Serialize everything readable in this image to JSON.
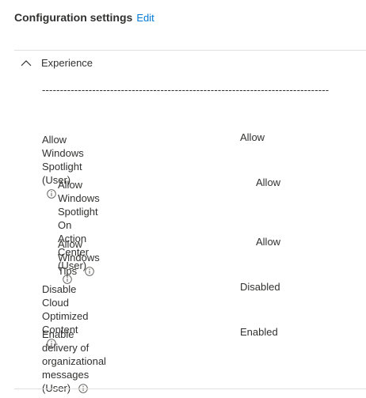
{
  "header": {
    "title": "Configuration settings",
    "edit_label": "Edit"
  },
  "section": {
    "title": "Experience",
    "expanded": true,
    "separator": "--------------------------------------------------------------------------------"
  },
  "settings": [
    {
      "label": "Allow Windows Spotlight (User)",
      "value": "Allow",
      "indent": 0
    },
    {
      "label_line1": "Allow Windows Spotlight On Action",
      "label_line2": "Center (User)",
      "value": "Allow",
      "indent": 1
    },
    {
      "label": "Allow Windows Tips",
      "value": "Allow",
      "indent": 1
    },
    {
      "label": "Disable Cloud Optimized Content",
      "value": "Disabled",
      "indent": 0
    },
    {
      "label_line1": "Enable delivery of organizational",
      "label_line2": "messages (User)",
      "value": "Enabled",
      "indent": 0
    }
  ],
  "colors": {
    "link": "#0078d4",
    "text": "#323130",
    "divider": "#e1dfdd"
  },
  "icons": {
    "chevron": "chevron-up-icon",
    "info": "info-icon"
  }
}
